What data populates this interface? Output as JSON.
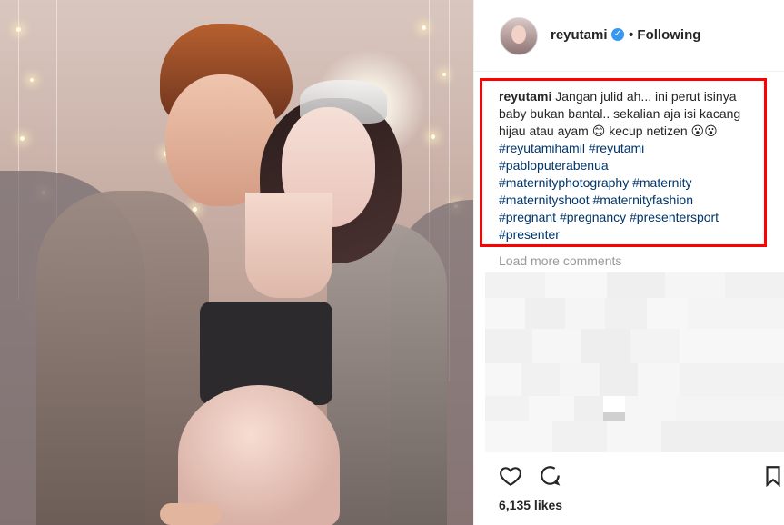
{
  "header": {
    "username": "reyutami",
    "verified_icon": "verified-badge-icon",
    "follow_label": "Following"
  },
  "caption": {
    "username": "reyutami",
    "text": "Jangan julid ah... ini perut isinya baby bukan bantal.. sekalian aja isi kacang hijau atau ayam 😊 kecup netizen 😮😮",
    "hashtags": [
      "#reyutamihamil",
      "#reyutami",
      "#pabloputerabenua",
      "#maternityphotography",
      "#maternity",
      "#maternityshoot",
      "#maternityfashion",
      "#pregnant",
      "#pregnancy",
      "#presentersport",
      "#presenter"
    ]
  },
  "comments": {
    "load_more": "Load more comments"
  },
  "actions": {
    "like_icon": "heart-icon",
    "comment_icon": "comment-icon",
    "save_icon": "bookmark-icon"
  },
  "stats": {
    "likes": "6,135 likes"
  },
  "colors": {
    "accent": "#3897f0",
    "hashtag": "#003569",
    "highlight_border": "#ff0000"
  }
}
